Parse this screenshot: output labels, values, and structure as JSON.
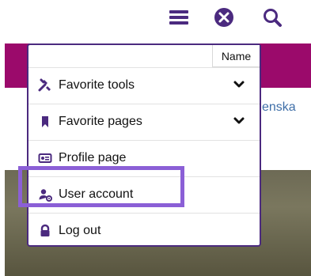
{
  "header": {
    "icons": [
      {
        "name": "menu-icon"
      },
      {
        "name": "close-icon"
      },
      {
        "name": "search-icon"
      }
    ]
  },
  "background": {
    "link_fragment": "enska"
  },
  "menu": {
    "name_tab_label": "Name",
    "items": [
      {
        "label": "Favorite tools",
        "icon": "tools-icon",
        "has_chevron": true
      },
      {
        "label": "Favorite pages",
        "icon": "bookmark-icon",
        "has_chevron": true
      },
      {
        "label": "Profile page",
        "icon": "id-card-icon",
        "has_chevron": false
      },
      {
        "label": "User account",
        "icon": "user-gear-icon",
        "has_chevron": false
      },
      {
        "label": "Log out",
        "icon": "lock-icon",
        "has_chevron": false
      }
    ]
  },
  "colors": {
    "accent": "#4b2a7f",
    "brand_band": "#9b0a6b",
    "highlight": "#8b5fd6",
    "link": "#3f6fa8"
  }
}
